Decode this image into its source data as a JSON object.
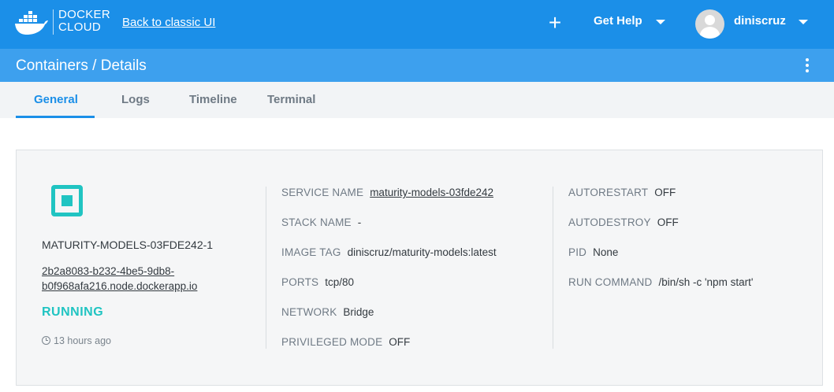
{
  "header": {
    "brand_line1": "DOCKER",
    "brand_line2": "CLOUD",
    "classic_link": "Back to classic UI",
    "plus_icon": "+",
    "help_label": "Get Help",
    "username": "diniscruz",
    "color": "#1b8fe8"
  },
  "subheader": {
    "breadcrumb": "Containers / Details",
    "color": "#3da0ee"
  },
  "tabs": [
    {
      "label": "General",
      "active": true
    },
    {
      "label": "Logs",
      "active": false
    },
    {
      "label": "Timeline",
      "active": false
    },
    {
      "label": "Terminal",
      "active": false
    }
  ],
  "container": {
    "name": "MATURITY-MODELS-03FDE242-1",
    "endpoint_line1": "2b2a8083-b232-4be5-9db8-",
    "endpoint_line2": "b0f968afa216.node.dockerapp.io",
    "status": "RUNNING",
    "status_color": "#20c4c2",
    "age": "13 hours ago"
  },
  "details_middle": [
    {
      "key": "SERVICE NAME",
      "value": "maturity-models-03fde242",
      "link": true
    },
    {
      "key": "STACK NAME",
      "value": "-",
      "link": false
    },
    {
      "key": "IMAGE TAG",
      "value": "diniscruz/maturity-models:latest",
      "link": false
    },
    {
      "key": "PORTS",
      "value": "tcp/80",
      "link": false
    },
    {
      "key": "NETWORK",
      "value": "Bridge",
      "link": false
    },
    {
      "key": "PRIVILEGED MODE",
      "value": "OFF",
      "link": false
    }
  ],
  "details_right": [
    {
      "key": "AUTORESTART",
      "value": "OFF"
    },
    {
      "key": "AUTODESTROY",
      "value": "OFF"
    },
    {
      "key": "PID",
      "value": "None"
    },
    {
      "key": "RUN COMMAND",
      "value": "/bin/sh -c 'npm start'"
    }
  ]
}
